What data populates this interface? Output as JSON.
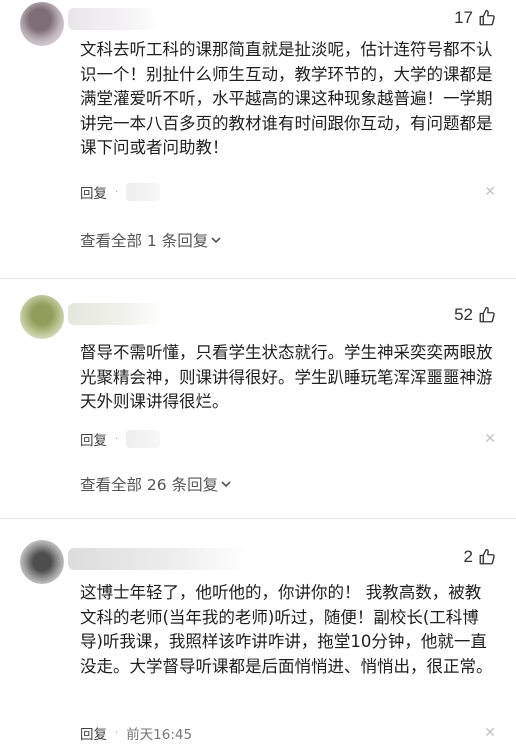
{
  "comments": [
    {
      "likes": "17",
      "text": "文科去听工科的课那简直就是扯淡呢，估计连符号都不认识一个！别扯什么师生互动，教学环节的，大学的课都是满堂灌爱听不听，水平越高的课这种现象越普遍！一学期讲完一本八百多页的教材谁有时间跟你互动，有问题都是课下问或者问助教！",
      "reply_label": "回复",
      "dot": "·",
      "time": "",
      "view_replies": "查看全部 1 条回复"
    },
    {
      "likes": "52",
      "text": "督导不需听懂，只看学生状态就行。学生神采奕奕两眼放光聚精会神，则课讲得很好。学生趴睡玩笔浑浑噩噩神游天外则课讲得很烂。",
      "reply_label": "回复",
      "dot": "·",
      "time": "",
      "view_replies": "查看全部 26 条回复"
    },
    {
      "likes": "2",
      "text": "这博士年轻了，他听他的，你讲你的！ 我教高数，被教文科的老师(当年我的老师)听过，随便！副校长(工科博导)听我课，我照样该咋讲咋讲，拖堂10分钟，他就一直没走。大学督导听课都是后面悄悄进、悄悄出，很正常。",
      "reply_label": "回复",
      "dot": "·",
      "time": "前天16:45"
    }
  ],
  "icons": {
    "like": "thumbs-up-icon",
    "close": "close-icon",
    "expand": "chevron-down-icon"
  }
}
